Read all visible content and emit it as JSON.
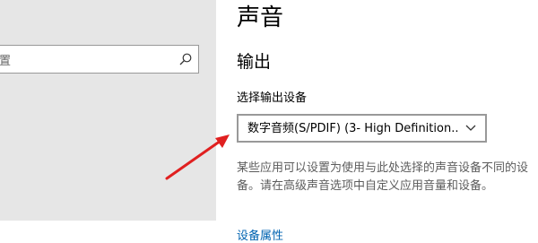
{
  "nav": {
    "search_value": "置"
  },
  "main": {
    "page_title": "声音",
    "output_section_title": "输出",
    "device_label": "选择输出设备",
    "selected_device": "数字音频(S/PDIF) (3- High Definition...",
    "help_text": "某些应用可以设置为使用与此处选择的声音设备不同的设备。请在高级声音选项中自定义应用音量和设备。",
    "device_properties_link": "设备属性"
  },
  "icons": {
    "search": "search-icon",
    "dropdown": "chevron-down-icon",
    "annotation": "red-arrow-icon"
  },
  "colors": {
    "link": "#0063b1",
    "annotation_arrow": "#e02020",
    "nav_background": "#e6e6e6"
  }
}
